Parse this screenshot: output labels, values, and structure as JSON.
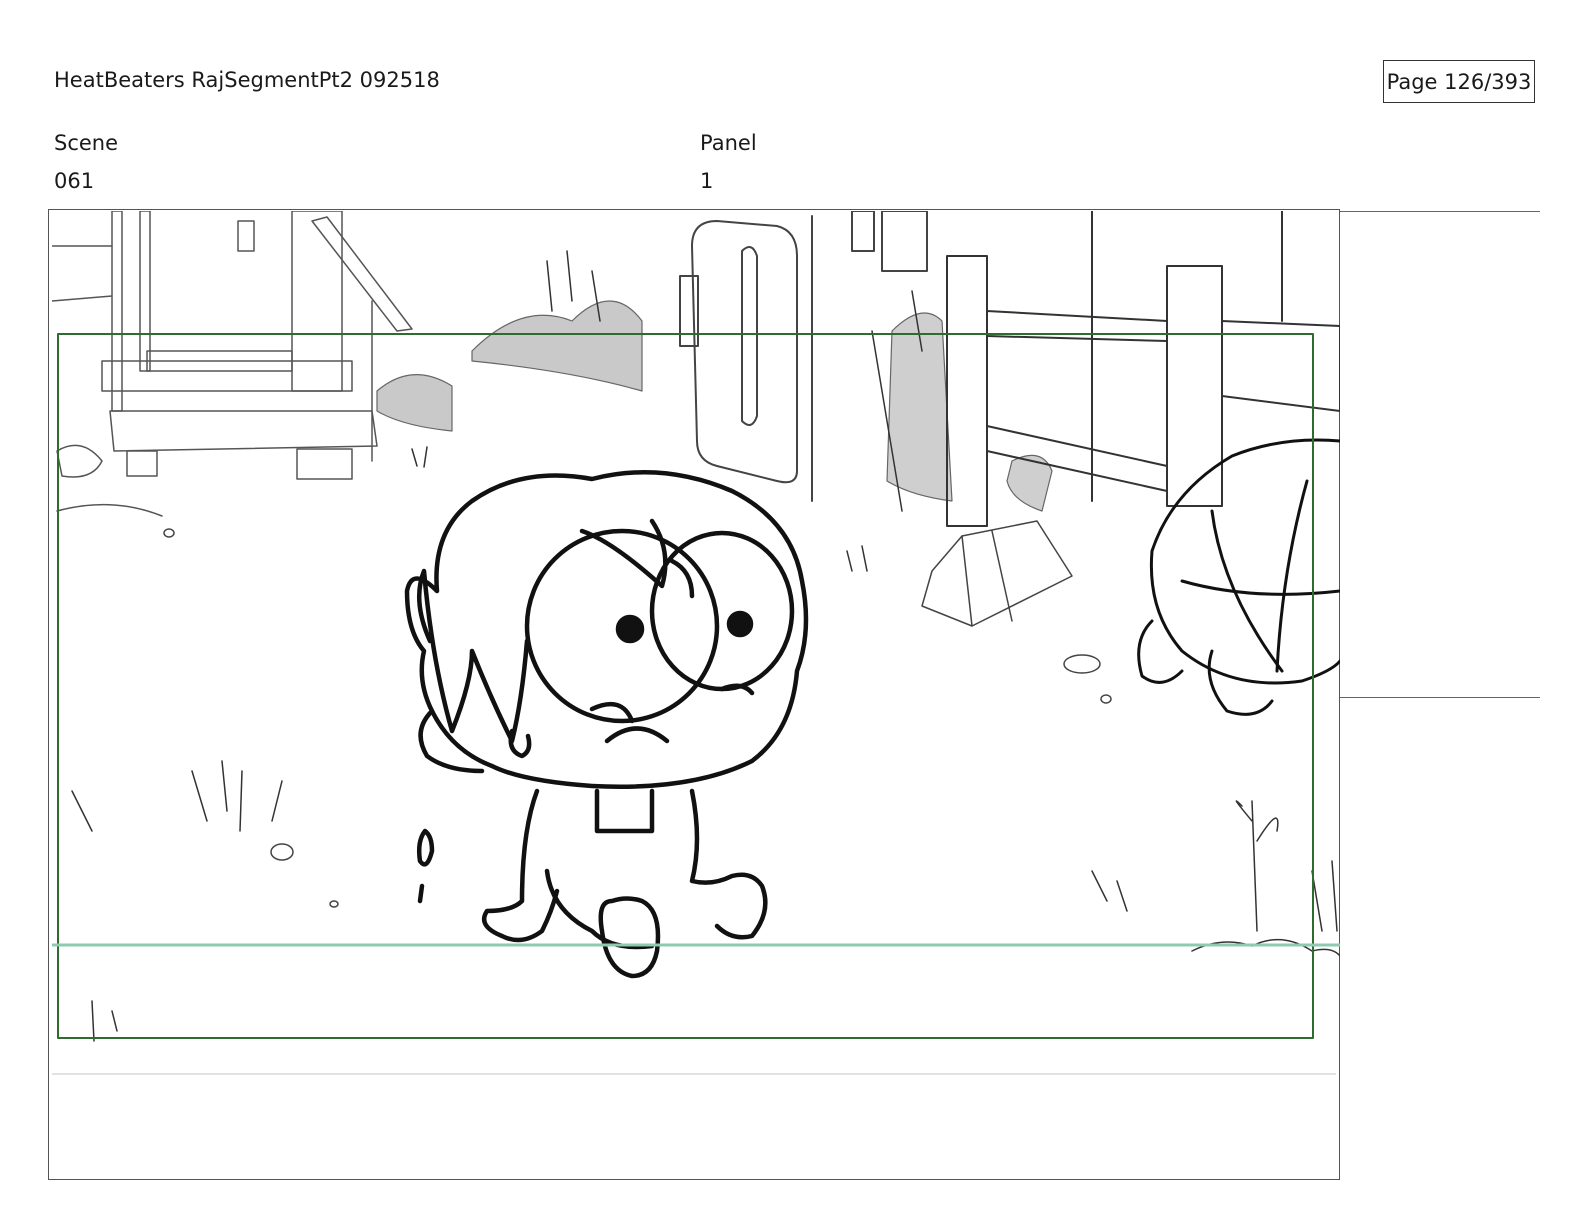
{
  "header": {
    "title": "HeatBeaters RajSegmentPt2 092518",
    "page": "Page 126/393"
  },
  "scene": {
    "label": "Scene",
    "value": "061"
  },
  "panel": {
    "label": "Panel",
    "value": "1"
  },
  "drawing": {
    "safe_frame_color": "#2e6b2e",
    "horizon_color": "#8fc9b0"
  }
}
